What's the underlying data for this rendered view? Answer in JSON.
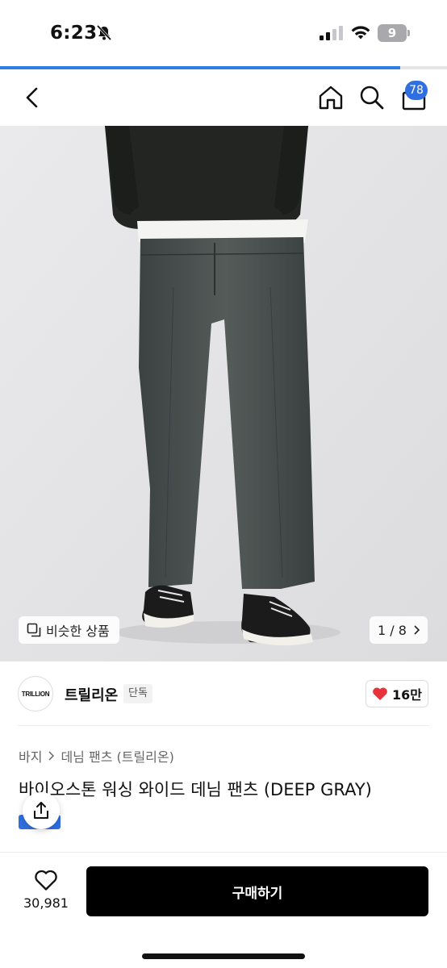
{
  "status_bar": {
    "time": "6:23",
    "battery": "9"
  },
  "page_load_progress": 0.895,
  "nav": {
    "cart_count": "78"
  },
  "colors": {
    "accent_blue": "#2f6fe0",
    "heart_red": "#e8333a",
    "buy_button": "#000000"
  },
  "gallery": {
    "similar_label": "비슷한 상품",
    "page_indicator": "1 / 8",
    "current_page": 1,
    "total_pages": 8
  },
  "brand": {
    "logo_text": "TRILLION",
    "name": "트릴리온",
    "tag": "단독",
    "likes": "16만"
  },
  "breadcrumb": {
    "category": "바지",
    "subcategory": "데님 팬츠 (트릴리온)"
  },
  "product": {
    "title": "바이오스톤 워싱 와이드 데님 팬츠 (DEEP GRAY)"
  },
  "bottom_bar": {
    "wish_count": "30,981",
    "buy_label": "구매하기"
  }
}
